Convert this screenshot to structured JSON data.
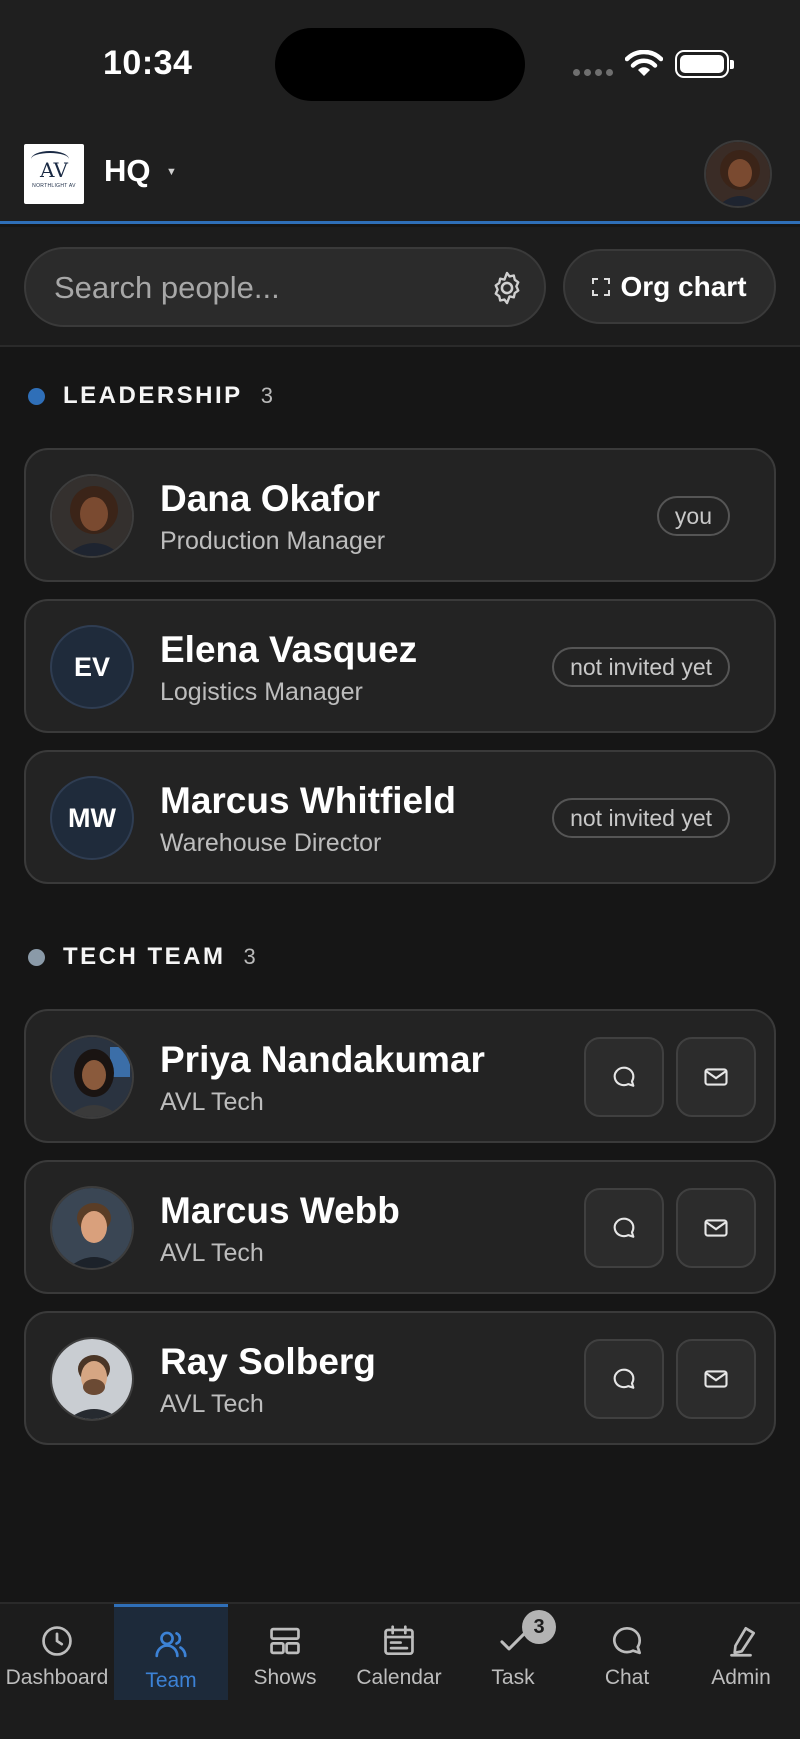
{
  "status_bar": {
    "time": "10:34"
  },
  "header": {
    "logo_letters": "AV",
    "logo_subtitle": "NORTHLIGHT AV",
    "workspace": "HQ"
  },
  "search": {
    "placeholder": "Search people...",
    "value": ""
  },
  "org_chart_label": "Org chart",
  "sections": [
    {
      "title": "LEADERSHIP",
      "count": "3",
      "dot_color": "#2f6fb8",
      "people": [
        {
          "name": "Dana Okafor",
          "role": "Production Manager",
          "badge": "you",
          "initials": ""
        },
        {
          "name": "Elena Vasquez",
          "role": "Logistics Manager",
          "badge": "not invited yet",
          "initials": "EV"
        },
        {
          "name": "Marcus Whitfield",
          "role": "Warehouse Director",
          "badge": "not invited yet",
          "initials": "MW"
        }
      ]
    },
    {
      "title": "TECH TEAM",
      "count": "3",
      "dot_color": "#8a9aa8",
      "people": [
        {
          "name": "Priya Nandakumar",
          "role": "AVL Tech"
        },
        {
          "name": "Marcus Webb",
          "role": "AVL Tech"
        },
        {
          "name": "Ray Solberg",
          "role": "AVL Tech"
        }
      ]
    }
  ],
  "nav": [
    {
      "label": "Dashboard",
      "icon": "clock-icon"
    },
    {
      "label": "Team",
      "icon": "users-icon",
      "active": true
    },
    {
      "label": "Shows",
      "icon": "grid-icon"
    },
    {
      "label": "Calendar",
      "icon": "calendar-icon"
    },
    {
      "label": "Task",
      "icon": "check-icon",
      "badge": "3"
    },
    {
      "label": "Chat",
      "icon": "chat-bubble-icon"
    },
    {
      "label": "Admin",
      "icon": "pen-icon"
    }
  ],
  "colors": {
    "accent": "#2f6fb8",
    "background": "#161616",
    "card": "#232323"
  }
}
